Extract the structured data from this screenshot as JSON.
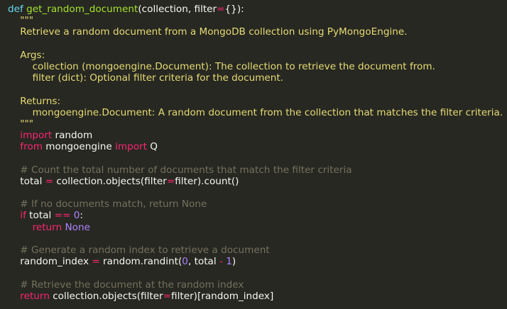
{
  "colors": {
    "background": "#272822",
    "plain": "#f8f8f2",
    "keyword": "#66d9ef",
    "function": "#a6e22e",
    "import": "#f92672",
    "string": "#e6db74",
    "comment": "#75715e",
    "number": "#ae81ff"
  },
  "code": {
    "l1": {
      "kw": "def",
      "fn": "get_random_document",
      "args_a": "(collection, filter",
      "eq": "=",
      "args_b": "{}):"
    },
    "l2": {
      "text": "    \"\"\""
    },
    "l3": {
      "text": "    Retrieve a random document from a MongoDB collection using PyMongoEngine."
    },
    "l4": {
      "text": ""
    },
    "l5": {
      "text": "    Args:"
    },
    "l6": {
      "text": "        collection (mongoengine.Document): The collection to retrieve the document from."
    },
    "l7": {
      "text": "        filter (dict): Optional filter criteria for the document."
    },
    "l8": {
      "text": ""
    },
    "l9": {
      "text": "    Returns:"
    },
    "l10": {
      "text": "        mongoengine.Document: A random document from the collection that matches the filter criteria."
    },
    "l11": {
      "text": "    \"\"\""
    },
    "l12": {
      "kw": "import",
      "rest": " random"
    },
    "l13": {
      "kw": "from",
      "mid": " mongoengine ",
      "kw2": "import",
      "rest": " Q"
    },
    "l14": {
      "text": ""
    },
    "l15": {
      "text": "    # Count the total number of documents that match the filter criteria"
    },
    "l16": {
      "a": "total ",
      "eq": "=",
      "b": " collection.objects(filter",
      "eq2": "=",
      "c": "filter).count()"
    },
    "l17": {
      "text": ""
    },
    "l18": {
      "text": "    # If no documents match, return None"
    },
    "l19": {
      "kw": "if",
      "a": " total ",
      "op": "==",
      "sp": " ",
      "num": "0",
      "end": ":"
    },
    "l20": {
      "kw": "return",
      "sp": " ",
      "none": "None"
    },
    "l21": {
      "text": ""
    },
    "l22": {
      "text": "    # Generate a random index to retrieve a document"
    },
    "l23": {
      "a": "random_index ",
      "eq": "=",
      "b": " random.randint(",
      "n0": "0",
      "c": ", total ",
      "minus": "-",
      "sp": " ",
      "n1": "1",
      "d": ")"
    },
    "l24": {
      "text": ""
    },
    "l25": {
      "text": "    # Retrieve the document at the random index"
    },
    "l26": {
      "kw": "return",
      "a": " collection.objects(filter",
      "eq": "=",
      "b": "filter)[random_index]"
    }
  }
}
